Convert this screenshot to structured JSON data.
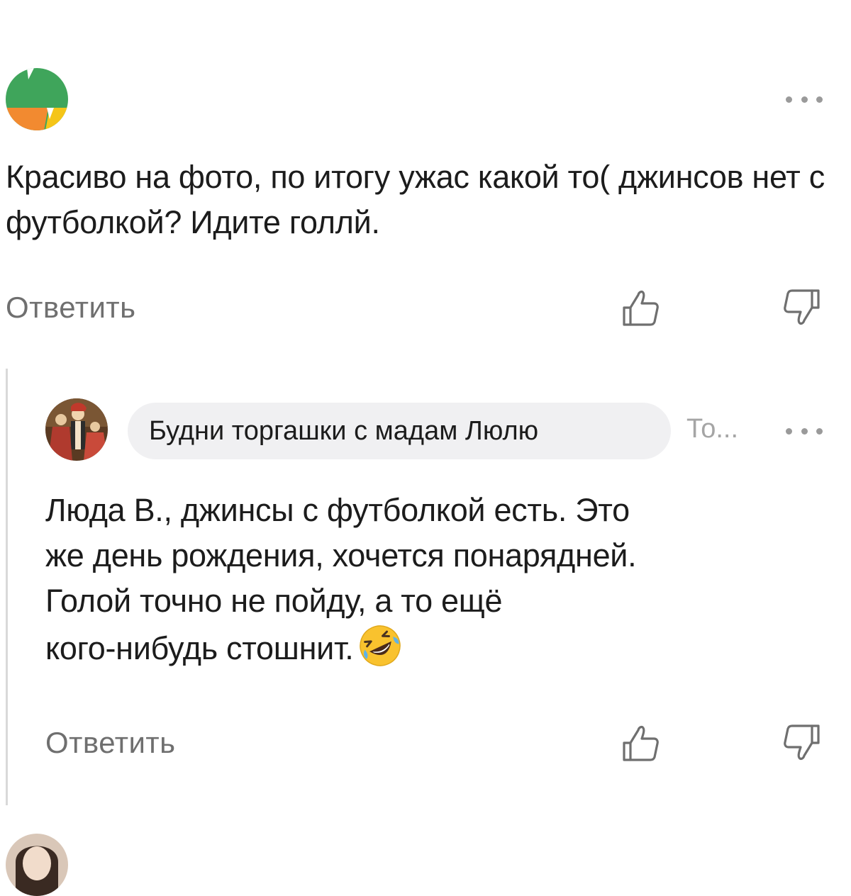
{
  "comments": [
    {
      "text": "Красиво на фото, по итогу ужас какой то( джинсов нет с футболкой? Идите голлй.",
      "reply_label": "Ответить",
      "like_icon": "thumbs-up-icon",
      "dislike_icon": "thumbs-down-icon",
      "menu_icon": "more-dots-icon",
      "avatar_colors": [
        "#3fa55b",
        "#f28a30",
        "#f5c518"
      ]
    },
    {
      "author": "Будни торгашки с мадам Люлю",
      "reply_to": "То...",
      "text_lines": [
        "Люда В., джинсы с футболкой есть. Это",
        "же день рождения, хочется понарядней.",
        "Голой точно не пойду, а то ещё",
        "кого-нибудь стошнит."
      ],
      "emoji": "rolling-on-floor-laughing-emoji",
      "reply_label": "Ответить",
      "like_icon": "thumbs-up-icon",
      "dislike_icon": "thumbs-down-icon",
      "menu_icon": "more-dots-icon"
    }
  ],
  "colors": {
    "text": "#1c1c1c",
    "muted": "#6f6f6f",
    "chip_bg": "#f0f0f2",
    "thread_line": "#d9d9d9"
  }
}
